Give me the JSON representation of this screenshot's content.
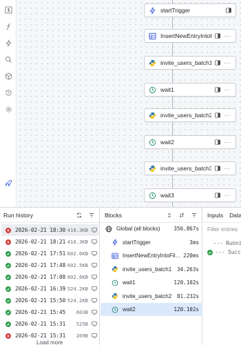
{
  "rail": {
    "icons": [
      "dollar-icon",
      "function-icon",
      "zap-icon",
      "search-icon",
      "package-icon",
      "history-icon",
      "settings-icon",
      "rocket-icon"
    ]
  },
  "flow": {
    "nodes": [
      {
        "label": "startTrigger",
        "icon": "zap-icon"
      },
      {
        "label": "InsertNewEntryIntoFil...",
        "icon": "table-icon"
      },
      {
        "label": "invite_users_batch1",
        "icon": "python-icon"
      },
      {
        "label": "wait1",
        "icon": "clock-icon"
      },
      {
        "label": "invite_users_batch2",
        "icon": "python-icon"
      },
      {
        "label": "wait2",
        "icon": "clock-icon"
      },
      {
        "label": "invite_users_batch3",
        "icon": "python-icon"
      },
      {
        "label": "wait3",
        "icon": "clock-icon"
      }
    ],
    "more_glyph": "···"
  },
  "run_history": {
    "title": "Run history",
    "rows": [
      {
        "date": "2026-02-21 18:30",
        "size": "410.3KB",
        "status": "error"
      },
      {
        "date": "2026-02-21 18:21",
        "size": "410.3KB",
        "status": "error"
      },
      {
        "date": "2026-02-21 17:51",
        "size": "602.6KB",
        "status": "success"
      },
      {
        "date": "2026-02-21 17:48",
        "size": "602.5KB",
        "status": "success"
      },
      {
        "date": "2026-02-21 17:08",
        "size": "602.6KB",
        "status": "success"
      },
      {
        "date": "2026-02-21 16:39",
        "size": "524.2KB",
        "status": "success"
      },
      {
        "date": "2026-02-21 15:50",
        "size": "524.2KB",
        "status": "success"
      },
      {
        "date": "2026-02-21 15:45",
        "size": "603B",
        "status": "success"
      },
      {
        "date": "2026-02-21 15:31",
        "size": "525B",
        "status": "success"
      },
      {
        "date": "2026-02-21 15:31",
        "size": "269B",
        "status": "error"
      }
    ],
    "load_more": "Load more"
  },
  "blocks": {
    "title": "Blocks",
    "rows": [
      {
        "label": "Global (all blocks)",
        "duration": "356.867s",
        "icon": "globe-icon"
      },
      {
        "label": "startTrigger",
        "duration": "3ms",
        "icon": "zap-icon"
      },
      {
        "label": "InsertNewEntryIntoFiles...",
        "duration": "220ms",
        "icon": "table-icon"
      },
      {
        "label": "invite_users_batch1",
        "duration": "34.263s",
        "icon": "python-icon"
      },
      {
        "label": "wait1",
        "duration": "120.102s",
        "icon": "clock-icon"
      },
      {
        "label": "invite_users_batch2",
        "duration": "81.232s",
        "icon": "python-icon"
      },
      {
        "label": "wait2",
        "duration": "120.102s",
        "icon": "clock-icon"
      }
    ]
  },
  "io": {
    "tabs": [
      "Inputs",
      "Data"
    ],
    "filter_placeholder": "Filter entries",
    "lines": [
      "--- Runnin",
      "--- Succes"
    ]
  },
  "colors": {
    "success": "#2e9e4d",
    "error": "#d63a3a",
    "selected_block": "#dce8fb",
    "selected_run": "#ebedf0",
    "accent_blue": "#3b5bdb",
    "python_blue": "#3776ab",
    "python_yellow": "#f0c419",
    "clock_teal": "#1f8a70"
  }
}
